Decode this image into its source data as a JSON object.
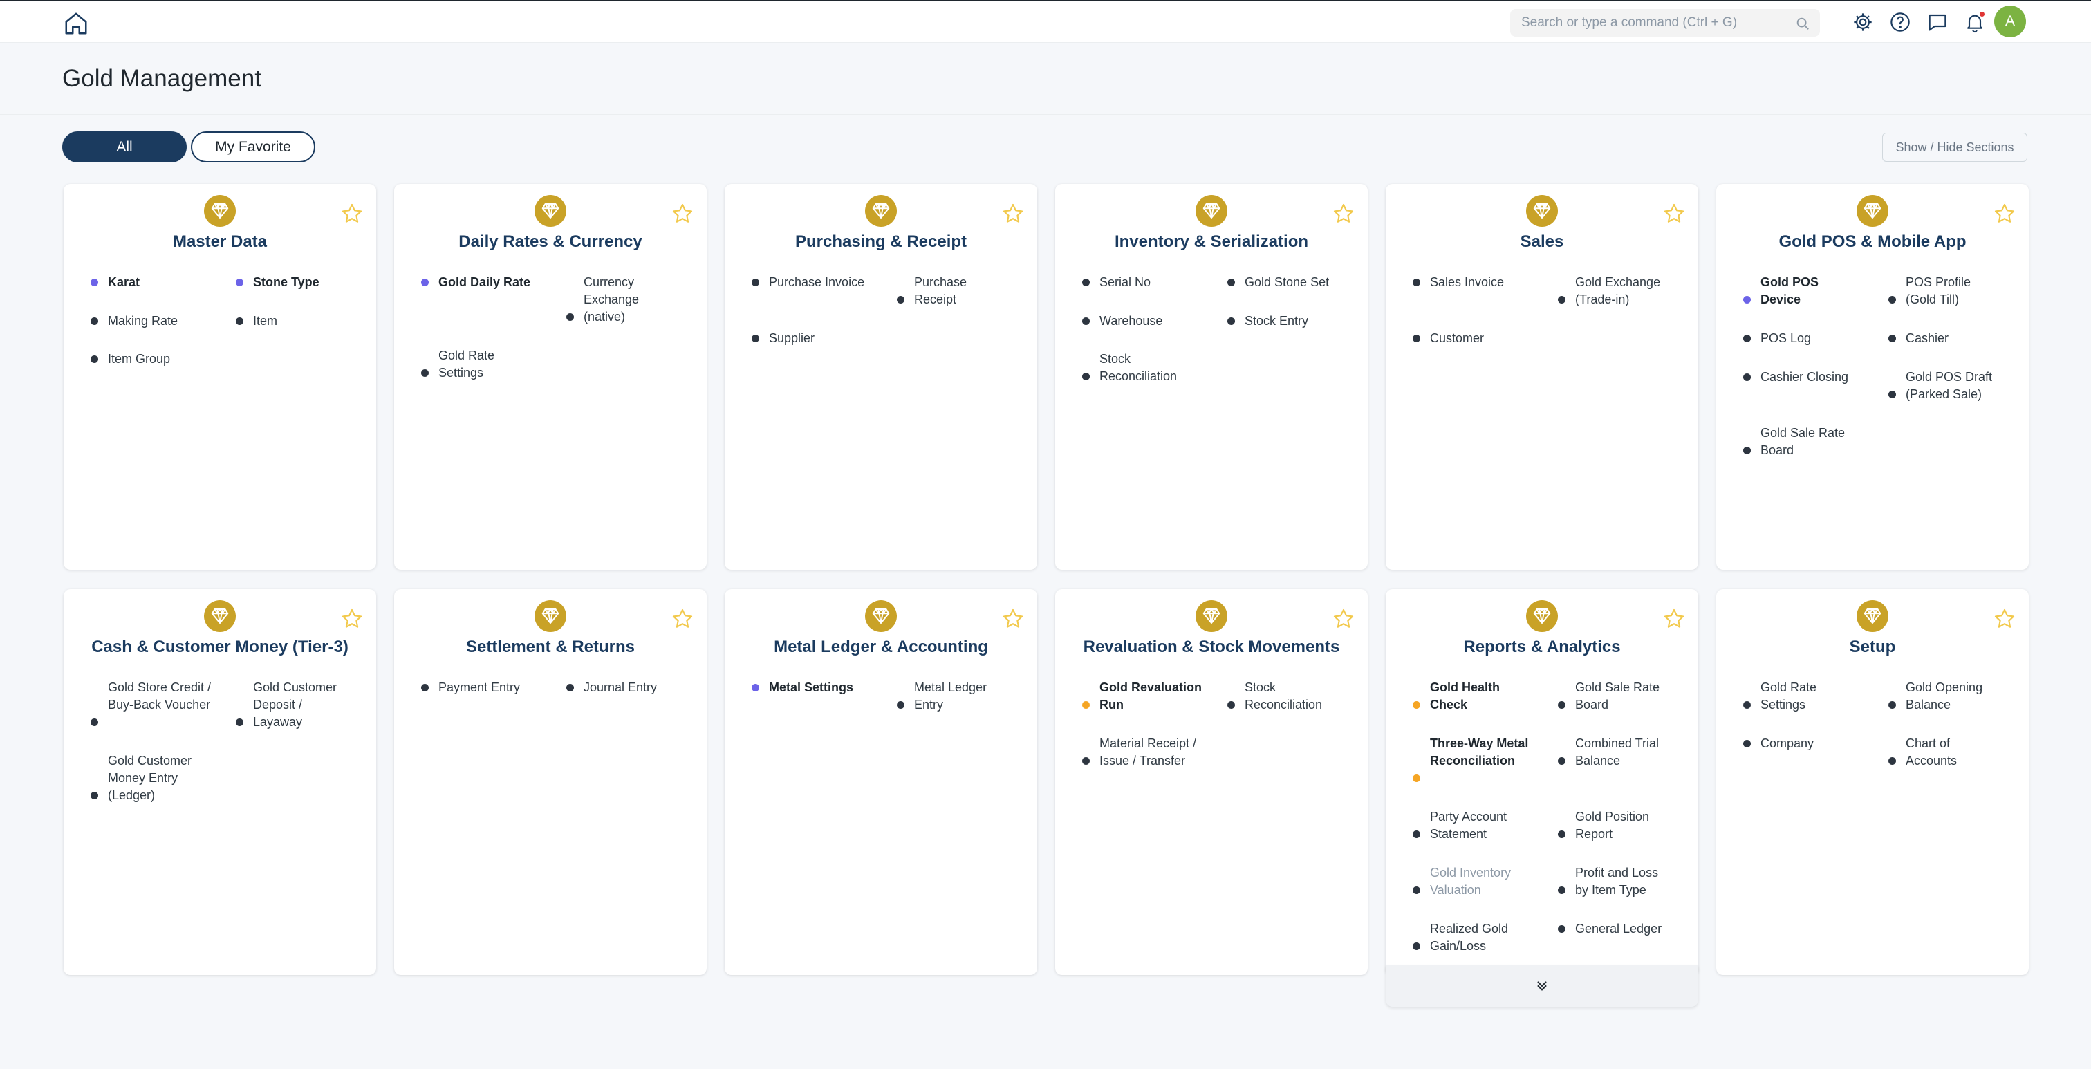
{
  "navbar": {
    "search_placeholder": "Search or type a command (Ctrl + G)",
    "avatar_initial": "A"
  },
  "page": {
    "title": "Gold Management",
    "filters": [
      "All",
      "My Favorite"
    ],
    "show_hide_label": "Show / Hide Sections"
  },
  "colors": {
    "accent": "#1b3b5f",
    "gem": "#c9a227",
    "star": "#f2c94c",
    "avatar": "#7cb342",
    "dot_blue": "#6c63e8",
    "dot_orange": "#f5a524"
  },
  "cards": [
    {
      "title": "Master Data",
      "links": [
        "Karat",
        "Stone Type",
        "Making Rate",
        "Item",
        "Item Group"
      ]
    },
    {
      "title": "Daily Rates & Currency",
      "links": [
        "Gold Daily Rate",
        "Currency Exchange (native)",
        "Gold Rate Settings"
      ]
    },
    {
      "title": "Purchasing & Receipt",
      "links": [
        "Purchase Invoice",
        "Purchase Receipt",
        "Supplier"
      ]
    },
    {
      "title": "Inventory & Serialization",
      "links": [
        "Serial No",
        "Gold Stone Set",
        "Warehouse",
        "Stock Entry",
        "Stock Reconciliation"
      ]
    },
    {
      "title": "Sales",
      "links": [
        "Sales Invoice",
        "Gold Exchange (Trade-in)",
        "Customer"
      ]
    },
    {
      "title": "Gold POS & Mobile App",
      "links": [
        "Gold POS Device",
        "POS Profile (Gold Till)",
        "POS Log",
        "Cashier",
        "Cashier Closing",
        "Gold POS Draft (Parked Sale)",
        "Gold Sale Rate Board"
      ]
    },
    {
      "title": "Cash & Customer Money (Tier-3)",
      "links": [
        "Gold Store Credit / Buy-Back Voucher",
        "Gold Customer Deposit / Layaway",
        "Gold Customer Money Entry (Ledger)"
      ]
    },
    {
      "title": "Settlement & Returns",
      "links": [
        "Payment Entry",
        "Journal Entry"
      ]
    },
    {
      "title": "Metal Ledger & Accounting",
      "links": [
        "Metal Settings",
        "Metal Ledger Entry"
      ]
    },
    {
      "title": "Revaluation & Stock Movements",
      "links": [
        "Gold Revaluation Run",
        "Stock Reconciliation",
        "Material Receipt / Issue / Transfer"
      ]
    },
    {
      "title": "Reports & Analytics",
      "links": [
        "Gold Health Check",
        "Gold Sale Rate Board",
        "Three-Way Metal Reconciliation",
        "Combined Trial Balance",
        "Party Account Statement",
        "Gold Position Report",
        "Gold Inventory Valuation",
        "Profit and Loss by Item Type",
        "Realized Gold Gain/Loss",
        "General Ledger"
      ]
    },
    {
      "title": "Setup",
      "links": [
        "Gold Rate Settings",
        "Gold Opening Balance",
        "Company",
        "Chart of Accounts"
      ]
    }
  ]
}
